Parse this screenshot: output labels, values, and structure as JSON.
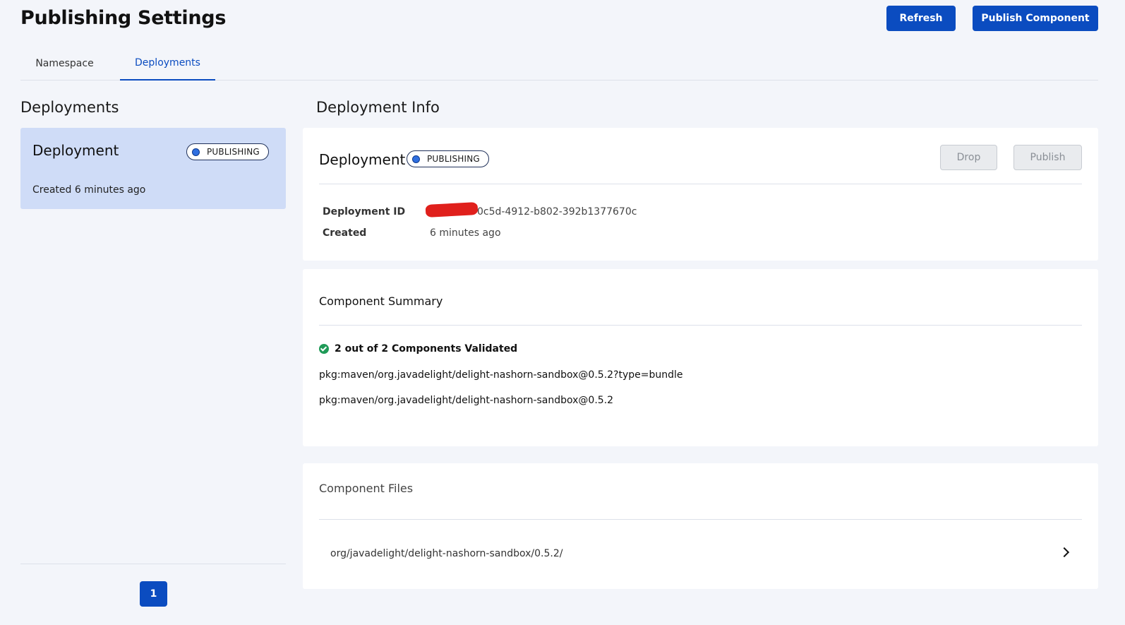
{
  "header": {
    "title": "Publishing Settings",
    "refresh_label": "Refresh",
    "publish_component_label": "Publish Component"
  },
  "tabs": [
    {
      "label": "Namespace",
      "active": false
    },
    {
      "label": "Deployments",
      "active": true
    }
  ],
  "left": {
    "heading": "Deployments",
    "card": {
      "title": "Deployment",
      "status": "PUBLISHING",
      "created": "Created 6 minutes ago"
    },
    "pagination": {
      "current_page": "1"
    }
  },
  "info": {
    "heading": "Deployment Info",
    "title": "Deployment",
    "status": "PUBLISHING",
    "drop_label": "Drop",
    "publish_label": "Publish",
    "deployment_id_label": "Deployment ID",
    "deployment_id_value": "0c5d-4912-b802-392b1377670c",
    "created_label": "Created",
    "created_value": "6 minutes ago"
  },
  "summary": {
    "title": "Component Summary",
    "validated": "2 out of 2 Components Validated",
    "components": [
      "pkg:maven/org.javadelight/delight-nashorn-sandbox@0.5.2?type=bundle",
      "pkg:maven/org.javadelight/delight-nashorn-sandbox@0.5.2"
    ]
  },
  "files": {
    "title": "Component Files",
    "items": [
      "org/javadelight/delight-nashorn-sandbox/0.5.2/"
    ]
  },
  "colors": {
    "primary": "#0b4cc0",
    "selected_card": "#cfdcf7",
    "status_dot": "#2f6fe0",
    "success": "#1f9a57",
    "background": "#f3f5fa"
  }
}
